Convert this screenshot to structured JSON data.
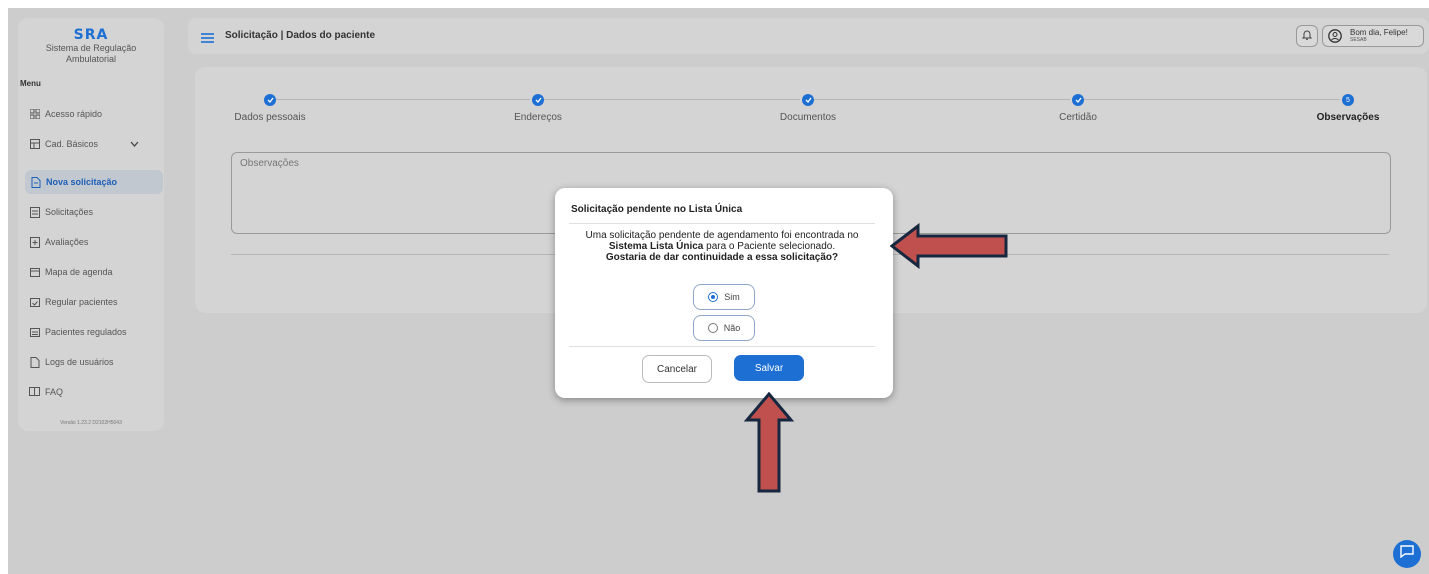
{
  "brand": {
    "logo": "SRA",
    "subtitle_line1": "Sistema de Regulação",
    "subtitle_line2": "Ambulatorial"
  },
  "sidebar": {
    "menu_label": "Menu",
    "items": [
      {
        "label": "Acesso rápido",
        "icon": "grid-icon"
      },
      {
        "label": "Cad. Básicos",
        "icon": "table-icon"
      },
      {
        "label": "Nova solicitação",
        "icon": "new-doc-icon"
      },
      {
        "label": "Solicitações",
        "icon": "doc-icon"
      },
      {
        "label": "Avaliações",
        "icon": "doc-plus-icon"
      },
      {
        "label": "Mapa de agenda",
        "icon": "calendar-icon"
      },
      {
        "label": "Regular pacientes",
        "icon": "calendar-check-icon"
      },
      {
        "label": "Pacientes regulados",
        "icon": "calendar-list-icon"
      },
      {
        "label": "Logs de usuários",
        "icon": "log-icon"
      },
      {
        "label": "FAQ",
        "icon": "book-icon"
      }
    ],
    "version": "Versão 1.23.2 D2102H5043"
  },
  "header": {
    "title": "Solicitação | Dados do paciente",
    "greeting": "Bom dia, Felipe!",
    "org": "SESAB"
  },
  "steps": [
    {
      "label": "Dados pessoais",
      "marker": ""
    },
    {
      "label": "Endereços",
      "marker": ""
    },
    {
      "label": "Documentos",
      "marker": ""
    },
    {
      "label": "Certidão",
      "marker": ""
    },
    {
      "label": "Observações",
      "marker": "5"
    }
  ],
  "form": {
    "observacoes_placeholder": "Observações"
  },
  "modal": {
    "title": "Solicitação pendente no Lista Única",
    "msg_part1": "Uma solicitação pendente de agendamento foi encontrada no ",
    "msg_bold": "Sistema Lista Única",
    "msg_part2": " para o Paciente selecionado.",
    "question": "Gostaria de dar continuidade a essa solicitação?",
    "option_yes": "Sim",
    "option_no": "Não",
    "selected": "Sim",
    "cancel_label": "Cancelar",
    "save_label": "Salvar"
  },
  "colors": {
    "primary": "#1d6fd4",
    "annotation_arrow": "#c0504d",
    "arrow_outline": "#17273f"
  }
}
